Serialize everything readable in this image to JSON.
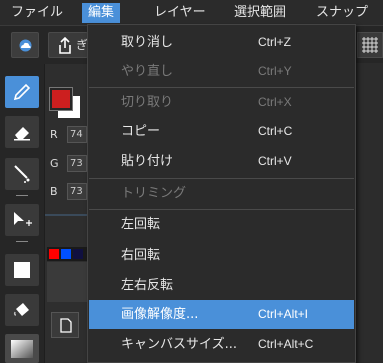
{
  "menubar": {
    "items": [
      {
        "label": "ファイル"
      },
      {
        "label": "編集"
      },
      {
        "label": "レイヤー"
      },
      {
        "label": "選択範囲"
      },
      {
        "label": "スナップ"
      }
    ]
  },
  "color_panel": {
    "r_label": "R",
    "r_value": "74",
    "g_label": "G",
    "g_value": "73",
    "b_label": "B",
    "b_value": "73"
  },
  "toolbar": {
    "partial_label": "ぎ"
  },
  "edit_menu": {
    "items": [
      {
        "label": "取り消し",
        "shortcut": "Ctrl+Z",
        "state": "enabled"
      },
      {
        "label": "やり直し",
        "shortcut": "Ctrl+Y",
        "state": "disabled"
      },
      {
        "label": "切り取り",
        "shortcut": "Ctrl+X",
        "state": "disabled"
      },
      {
        "label": "コピー",
        "shortcut": "Ctrl+C",
        "state": "enabled"
      },
      {
        "label": "貼り付け",
        "shortcut": "Ctrl+V",
        "state": "enabled"
      },
      {
        "label": "トリミング",
        "shortcut": "",
        "state": "disabled"
      },
      {
        "label": "左回転",
        "shortcut": "",
        "state": "enabled"
      },
      {
        "label": "右回転",
        "shortcut": "",
        "state": "enabled"
      },
      {
        "label": "左右反転",
        "shortcut": "",
        "state": "enabled"
      },
      {
        "label": "画像解像度...",
        "shortcut": "Ctrl+Alt+I",
        "state": "highlighted"
      },
      {
        "label": "キャンバスサイズ...",
        "shortcut": "Ctrl+Alt+C",
        "state": "enabled"
      }
    ]
  },
  "colors": {
    "accent": "#4a90d9",
    "primary_swatch": "#cc1f1f",
    "secondary_swatch": "#ffffff"
  }
}
